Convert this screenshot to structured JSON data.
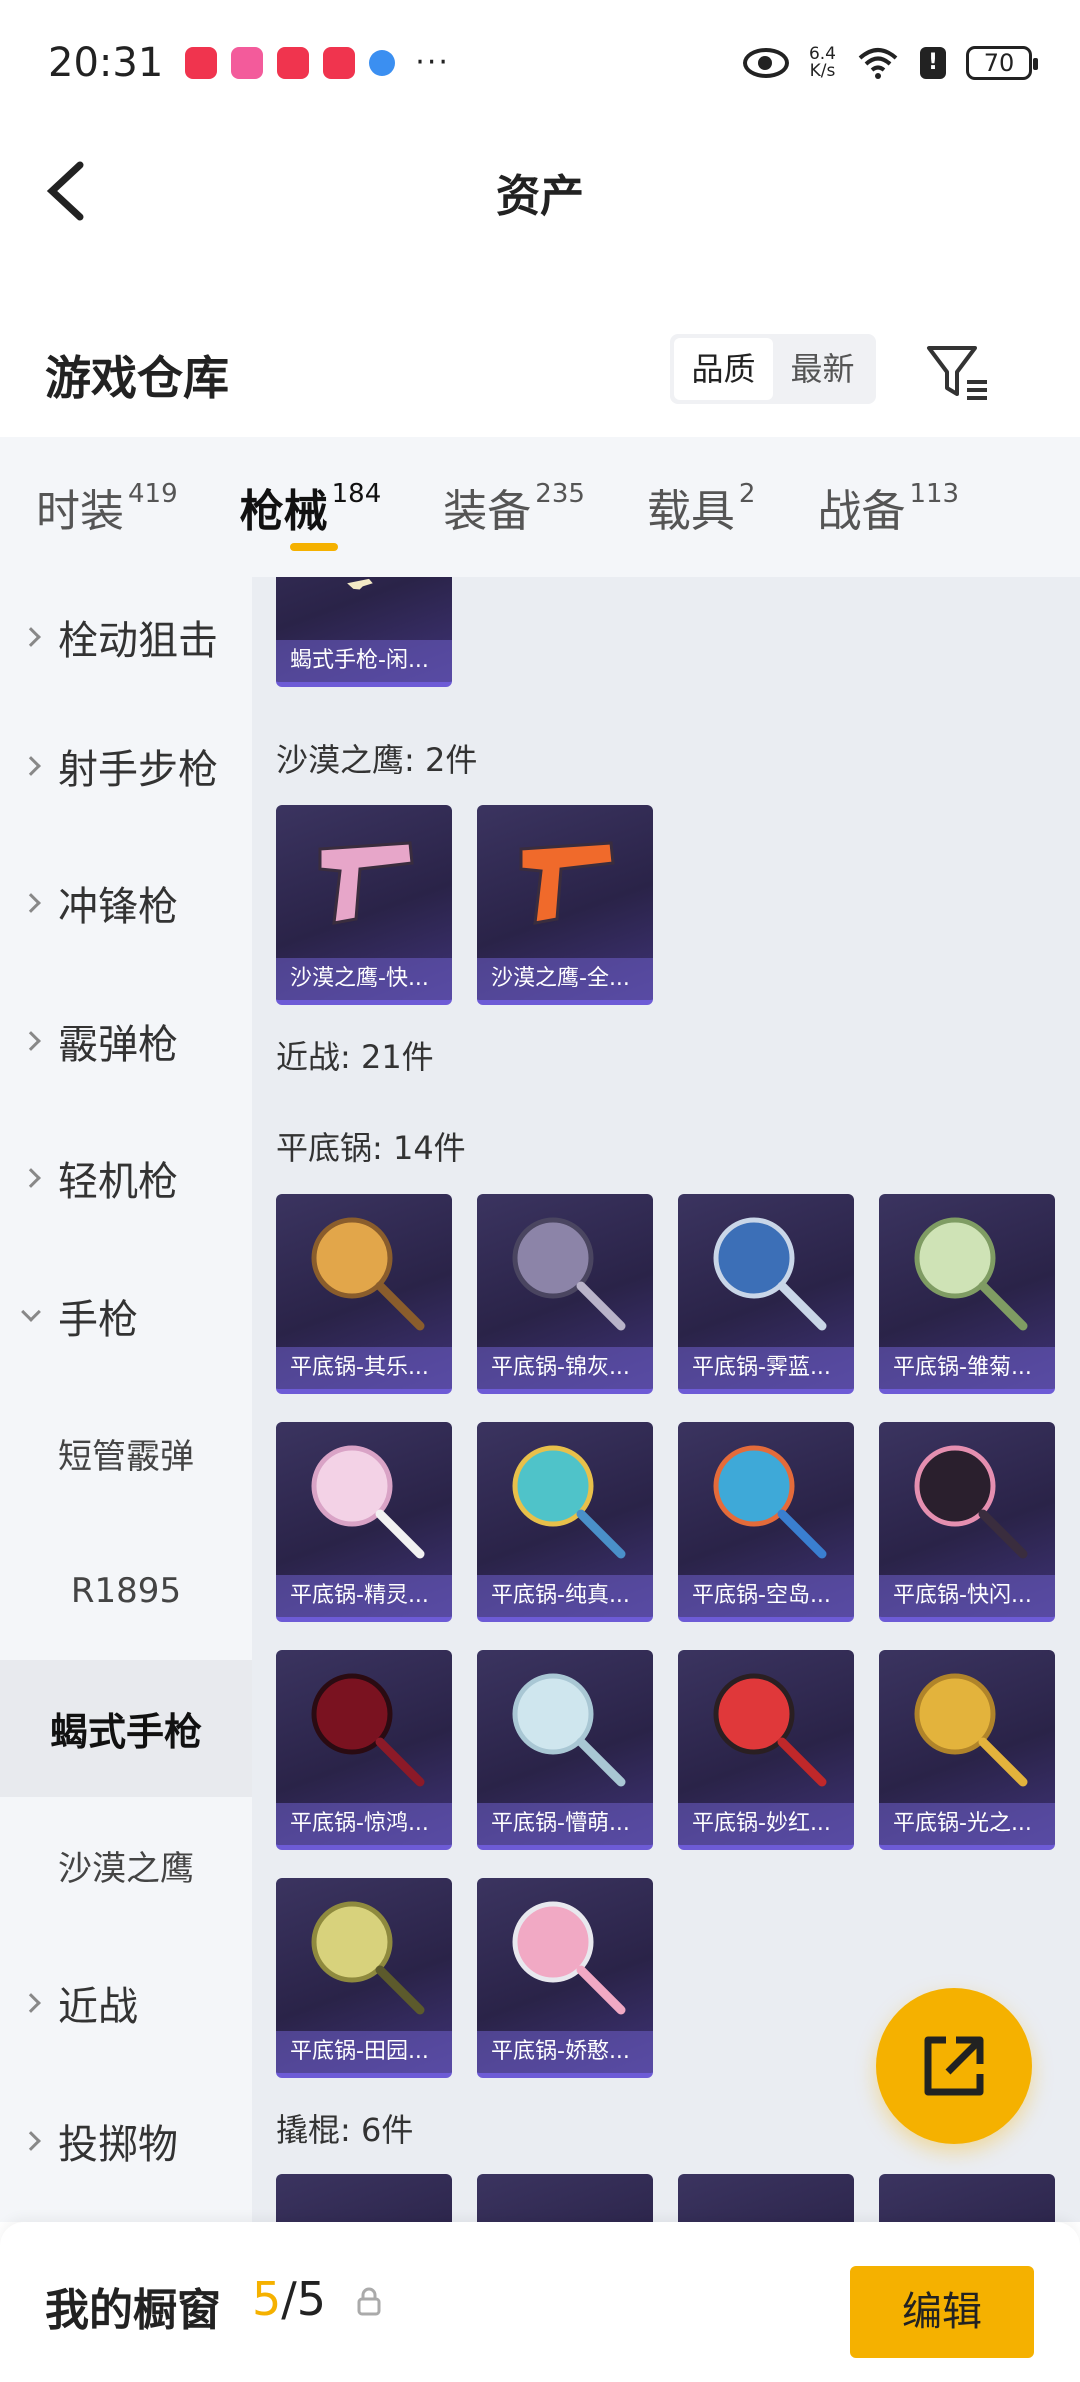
{
  "status": {
    "time": "20:31",
    "speed_top": "6.4",
    "speed_unit": "K/s",
    "battery": "70",
    "more": "···"
  },
  "header": {
    "title": "资产"
  },
  "section": {
    "title": "游戏仓库",
    "sort_quality": "品质",
    "sort_newest": "最新"
  },
  "tabs": [
    {
      "label": "时装",
      "count": "419"
    },
    {
      "label": "枪械",
      "count": "184"
    },
    {
      "label": "装备",
      "count": "235"
    },
    {
      "label": "载具",
      "count": "2"
    },
    {
      "label": "战备",
      "count": "113"
    }
  ],
  "nav": [
    {
      "label": "栓动狙击"
    },
    {
      "label": "射手步枪"
    },
    {
      "label": "冲锋枪"
    },
    {
      "label": "霰弹枪"
    },
    {
      "label": "轻机枪"
    },
    {
      "label": "手枪"
    },
    {
      "label": "短管霰弹"
    },
    {
      "label": "R1895"
    },
    {
      "label": "蝎式手枪"
    },
    {
      "label": "沙漠之鹰"
    },
    {
      "label": "近战"
    },
    {
      "label": "投掷物"
    }
  ],
  "groups": {
    "deagle": "沙漠之鹰: 2件",
    "melee": "近战: 21件",
    "pan": "平底锅: 14件",
    "crowbar": "撬棍: 6件"
  },
  "items": {
    "scorpion": [
      "蝎式手枪-闲..."
    ],
    "deagle": [
      "沙漠之鹰-快...",
      "沙漠之鹰-全..."
    ],
    "pan": [
      "平底锅-其乐...",
      "平底锅-锦灰...",
      "平底锅-霁蓝...",
      "平底锅-雏菊...",
      "平底锅-精灵...",
      "平底锅-纯真...",
      "平底锅-空岛...",
      "平底锅-快闪...",
      "平底锅-惊鸿...",
      "平底锅-懵萌...",
      "平底锅-妙红...",
      "平底锅-光之...",
      "平底锅-田园...",
      "平底锅-娇憨..."
    ]
  },
  "bottom": {
    "label": "我的橱窗",
    "current": "5",
    "total": "/5",
    "edit": "编辑"
  },
  "colors": {
    "accent": "#f5b100",
    "tile_bg": "#2a2348",
    "tile_caption": "#6e5ec8"
  }
}
